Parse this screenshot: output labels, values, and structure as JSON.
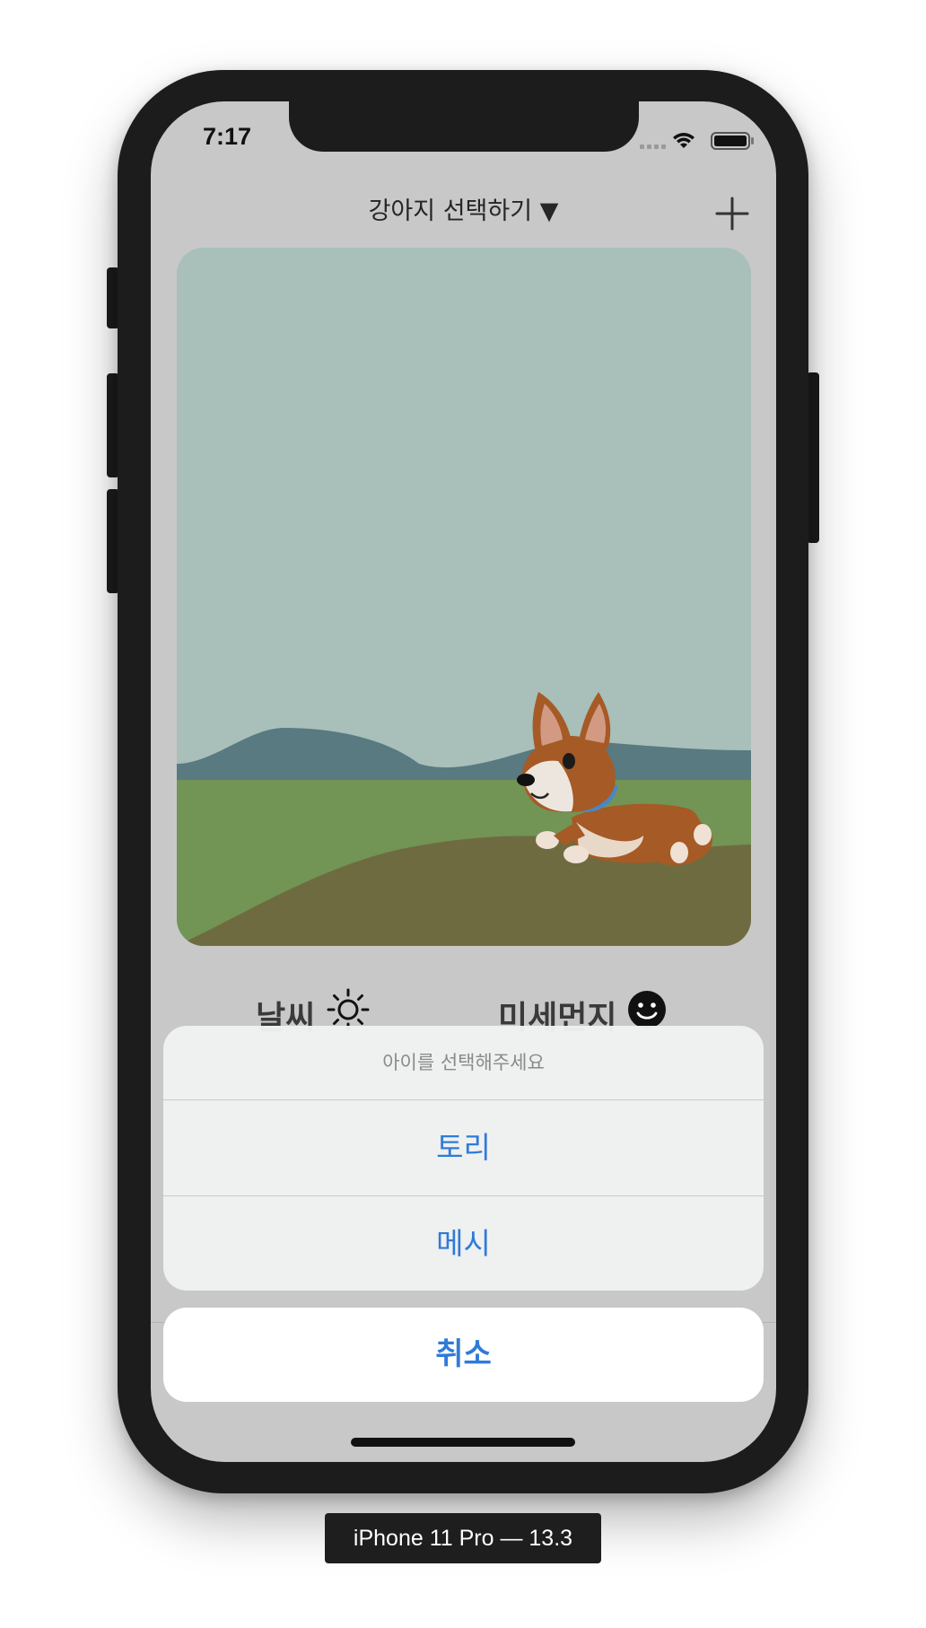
{
  "status_bar": {
    "time": "7:17"
  },
  "header": {
    "title": "강아지 선택하기 ▼",
    "add_icon": "plus-icon"
  },
  "scene": {
    "description_icon": "corgi-running-illustration"
  },
  "info": {
    "weather_label": "날씨",
    "weather_icon": "sun-icon",
    "dust_label": "미세먼지",
    "dust_icon": "smile-icon"
  },
  "action_sheet": {
    "title": "아이를 선택해주세요",
    "options": [
      "토리",
      "메시"
    ],
    "cancel": "취소"
  },
  "simulator": {
    "label": "iPhone 11 Pro — 13.3"
  },
  "colors": {
    "accent": "#2f7bd8",
    "screen_bg": "#c8c8c8",
    "frame": "#1c1c1c"
  }
}
